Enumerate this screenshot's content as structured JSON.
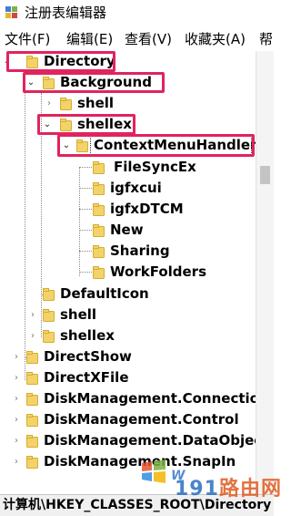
{
  "window": {
    "title": "注册表编辑器",
    "app_icon": "regedit-icon"
  },
  "menu": [
    "文件(F)",
    "编辑(E)",
    "查看(V)",
    "收藏夹(A)",
    "帮"
  ],
  "tree": {
    "items": [
      {
        "label": "Directory",
        "level": 0,
        "expanded": true
      },
      {
        "label": "Background",
        "level": 1,
        "expanded": true
      },
      {
        "label": "shell",
        "level": 2,
        "expanded": false
      },
      {
        "label": "shellex",
        "level": 2,
        "expanded": true
      },
      {
        "label": "ContextMenuHandlers",
        "level": 3,
        "expanded": true,
        "selected": true
      },
      {
        "label": "FileSyncEx",
        "level": 4
      },
      {
        "label": "igfxcui",
        "level": 4
      },
      {
        "label": "igfxDTCM",
        "level": 4
      },
      {
        "label": "New",
        "level": 4
      },
      {
        "label": "Sharing",
        "level": 4
      },
      {
        "label": "WorkFolders",
        "level": 4
      },
      {
        "label": "DefaultIcon",
        "level": 1
      },
      {
        "label": "shell",
        "level": 1,
        "expanded": false
      },
      {
        "label": "shellex",
        "level": 1,
        "expanded": false
      },
      {
        "label": "DirectShow",
        "level": 0,
        "expanded": false
      },
      {
        "label": "DirectXFile",
        "level": 0,
        "expanded": false
      },
      {
        "label": "DiskManagement.Connection",
        "level": 0,
        "expanded": false
      },
      {
        "label": "DiskManagement.Control",
        "level": 0,
        "expanded": false
      },
      {
        "label": "DiskManagement.DataObject",
        "level": 0,
        "expanded": false
      },
      {
        "label": "DiskManagement.SnapIn",
        "level": 0,
        "expanded": false
      }
    ]
  },
  "highlight_color": "#e0245e",
  "folder_color": "#f2d36b",
  "status": {
    "path": "计算机\\HKEY_CLASSES_ROOT\\Directory"
  },
  "watermark": {
    "brand_num": "191",
    "brand_text": "路由网",
    "win_text": "W"
  }
}
